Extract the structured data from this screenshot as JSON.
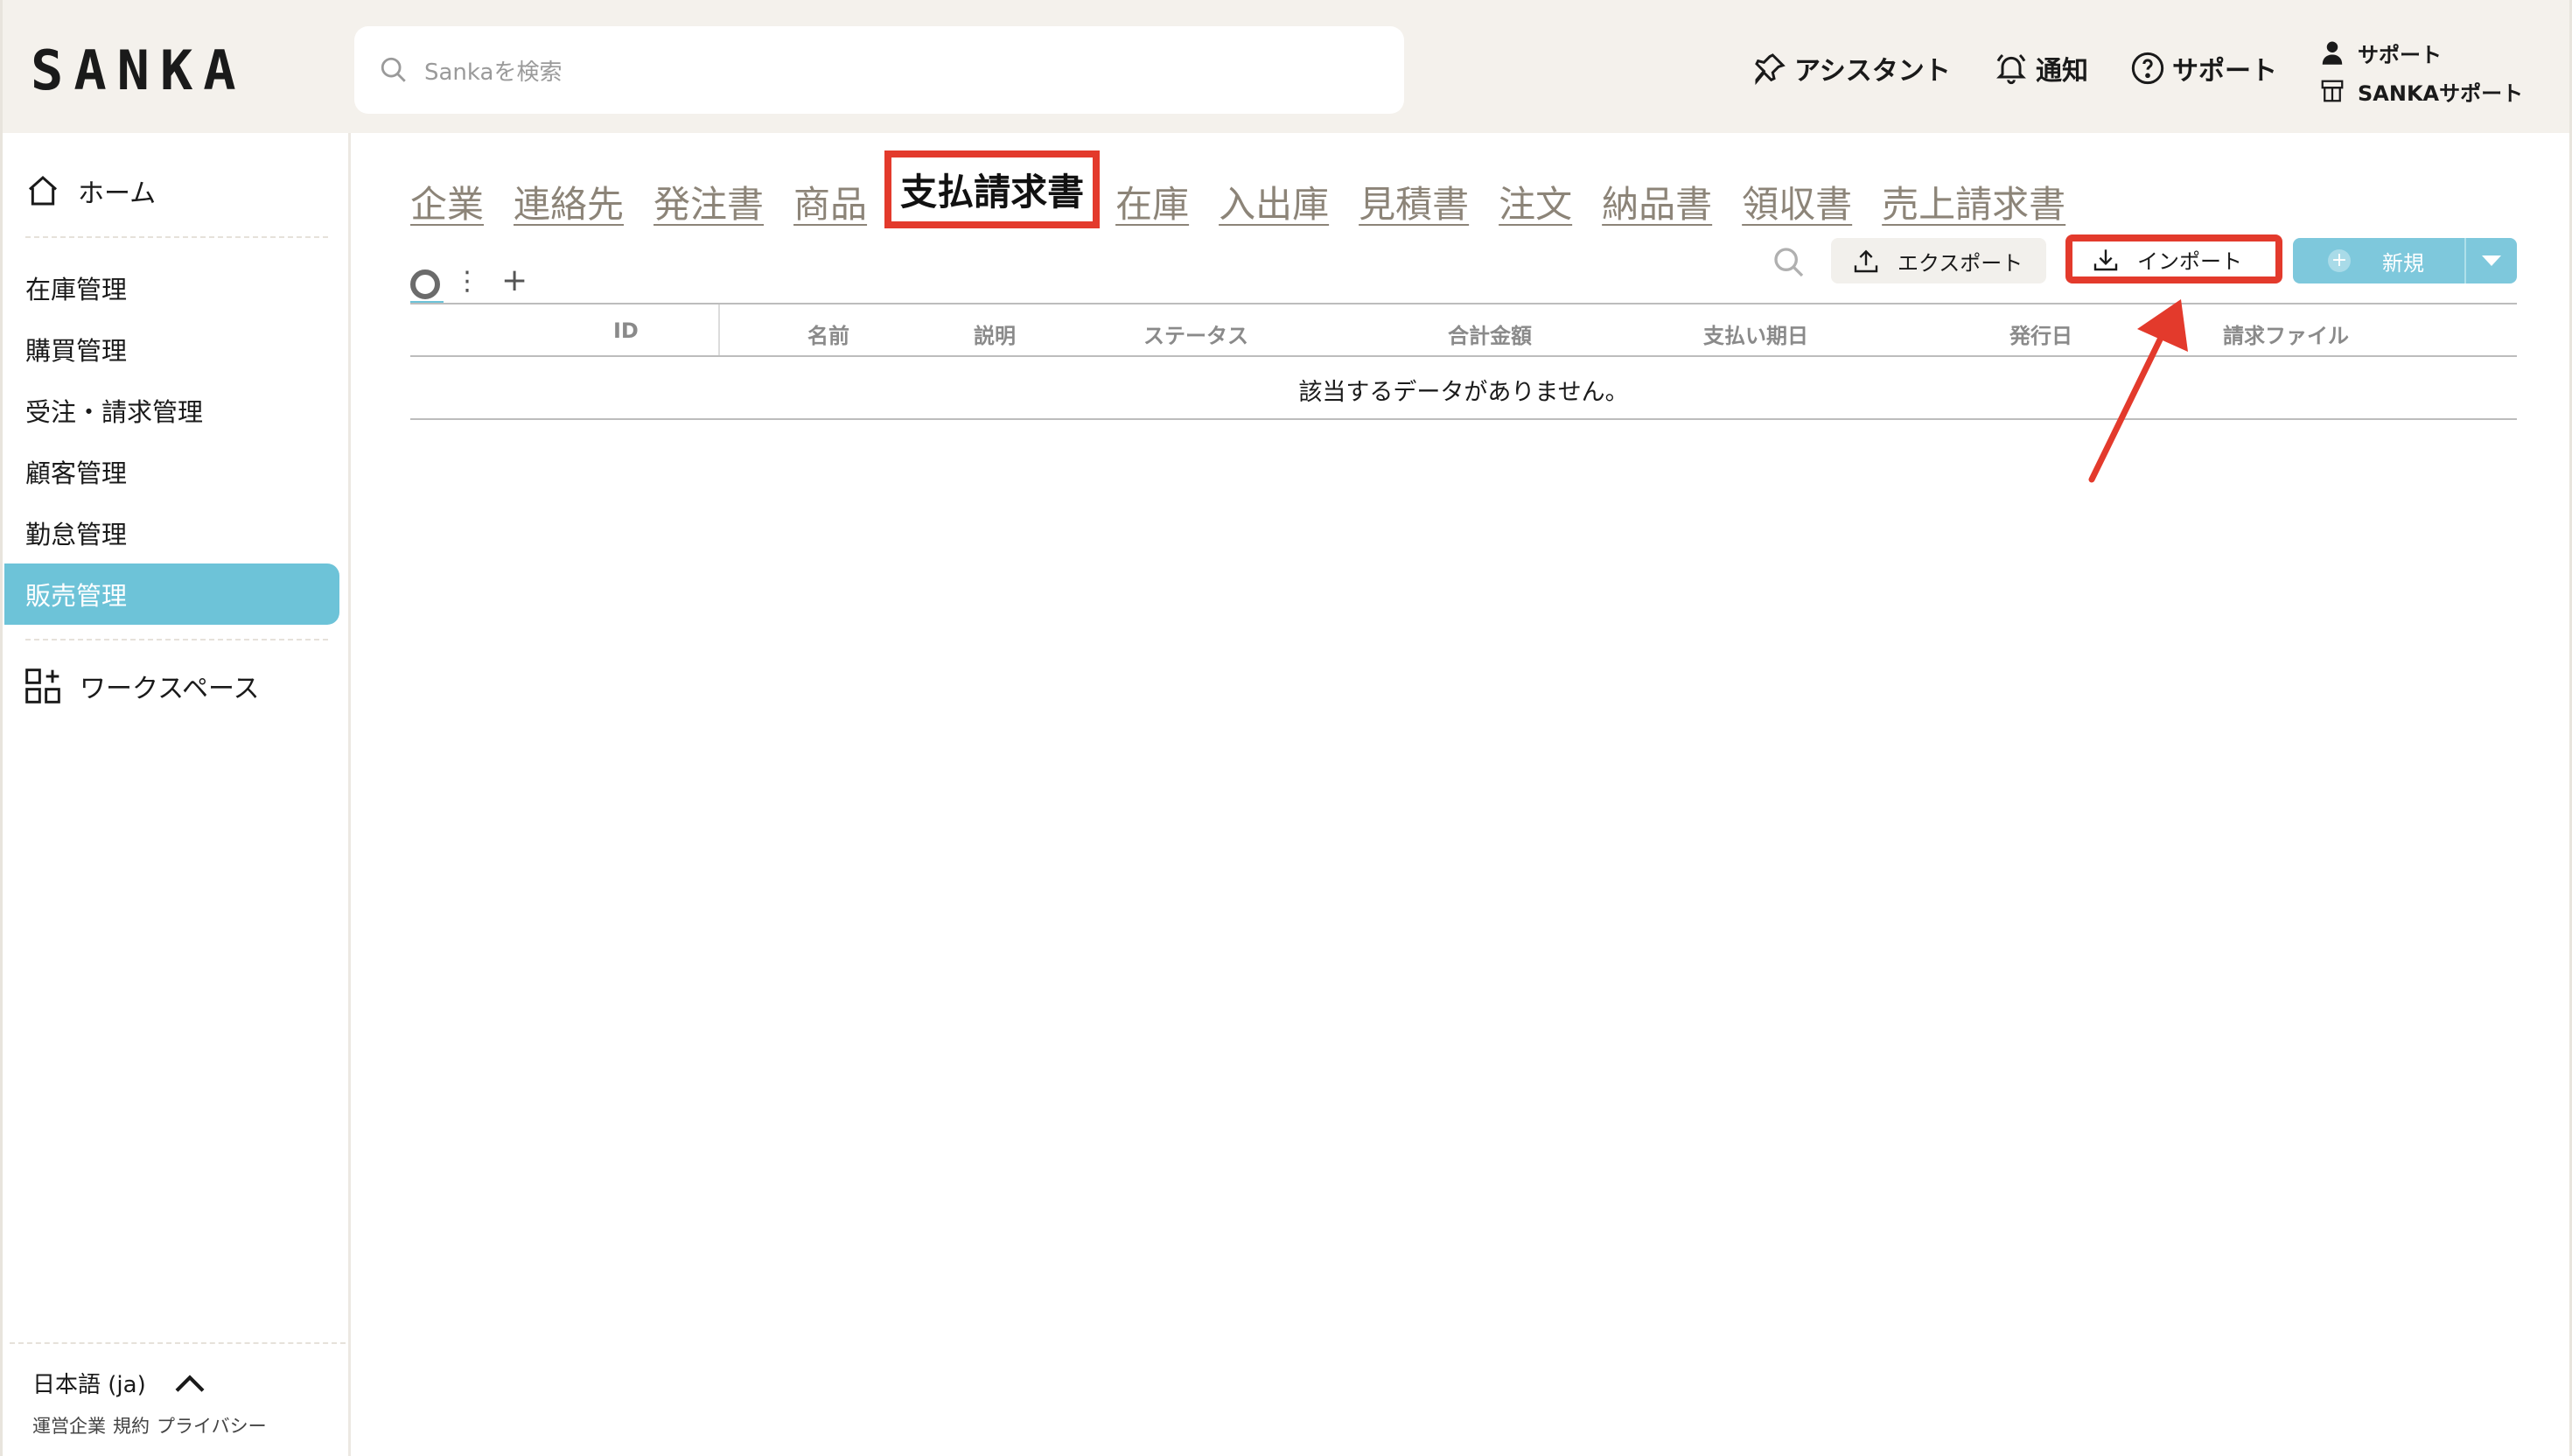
{
  "header": {
    "logo": "SANKA",
    "search_placeholder": "Sankaを検索",
    "assistant_label": "アシスタント",
    "notification_label": "通知",
    "support_label": "サポート",
    "user": {
      "name": "サポート",
      "workspace": "SANKAサポート"
    }
  },
  "sidebar": {
    "home_label": "ホーム",
    "items": [
      {
        "label": "在庫管理"
      },
      {
        "label": "購買管理"
      },
      {
        "label": "受注・請求管理"
      },
      {
        "label": "顧客管理"
      },
      {
        "label": "勤怠管理"
      },
      {
        "label": "販売管理",
        "active": true
      }
    ],
    "workspace_label": "ワークスペース",
    "language": "日本語 (ja)",
    "footer_links": [
      "運営企業",
      "規約",
      "プライバシー"
    ]
  },
  "tabs": [
    {
      "label": "企業"
    },
    {
      "label": "連絡先"
    },
    {
      "label": "発注書"
    },
    {
      "label": "商品"
    },
    {
      "label": "支払請求書",
      "active": true
    },
    {
      "label": "在庫"
    },
    {
      "label": "入出庫"
    },
    {
      "label": "見積書"
    },
    {
      "label": "注文"
    },
    {
      "label": "納品書"
    },
    {
      "label": "領収書"
    },
    {
      "label": "売上請求書"
    }
  ],
  "view_bar": {
    "more_icon": "⋮",
    "add_icon": "+"
  },
  "toolbar": {
    "export_label": "エクスポート",
    "import_label": "インポート",
    "new_label": "新規"
  },
  "table": {
    "columns": [
      "ID",
      "名前",
      "説明",
      "ステータス",
      "合計金額",
      "支払い期日",
      "発行日",
      "請求ファイル"
    ],
    "empty_message": "該当するデータがありません。"
  },
  "colors": {
    "accent": "#6dc3d8",
    "highlight": "#e33a2c",
    "header_bg": "#f4f1ec"
  }
}
